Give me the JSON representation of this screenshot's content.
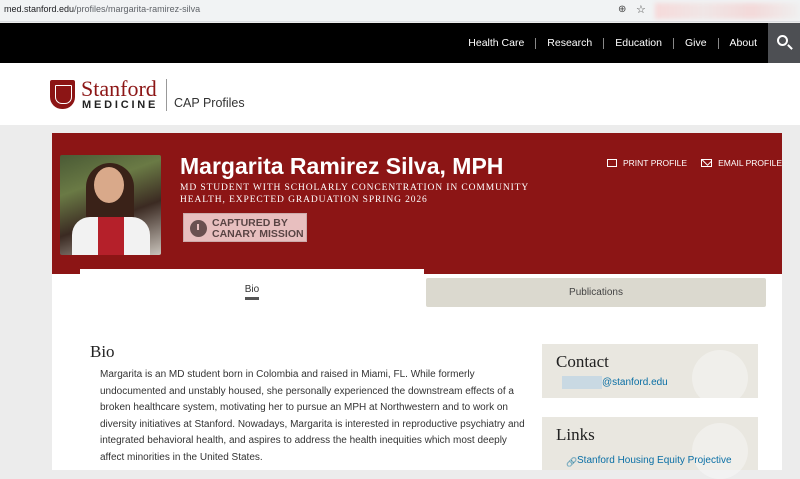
{
  "browser": {
    "url_host": "med.stanford.edu",
    "url_path": "/profiles/margarita-ramirez-silva"
  },
  "topnav": {
    "items": [
      "Health Care",
      "Research",
      "Education",
      "Give",
      "About"
    ]
  },
  "brand": {
    "wordmark": "Stanford",
    "subwordmark": "MEDICINE",
    "section": "CAP Profiles"
  },
  "profile": {
    "name": "Margarita Ramirez Silva, MPH",
    "title": "MD Student with Scholarly Concentration in Community Health, expected graduation Spring 2026",
    "badge": "Captured by Canary Mission",
    "print_label": "PRINT PROFILE",
    "email_label": "EMAIL PROFILE"
  },
  "tabs": {
    "bio": "Bio",
    "publications": "Publications"
  },
  "bio": {
    "heading": "Bio",
    "text": "Margarita is an MD student born in Colombia and raised in Miami, FL. While formerly undocumented and unstably housed, she personally experienced the downstream effects of a broken healthcare system, motivating her to pursue an MPH at Northwestern and to work on diversity initiatives at Stanford. Nowadays, Margarita is interested in reproductive psychiatry and integrated behavioral health, and aspires to address the health inequities which most deeply affect minorities in the United States."
  },
  "contact": {
    "heading": "Contact",
    "email_domain": "@stanford.edu"
  },
  "links": {
    "heading": "Links",
    "items": [
      "Stanford Housing Equity Projective"
    ]
  },
  "colors": {
    "cardinal": "#8c1515",
    "nav_bg": "#000000",
    "link": "#0a6fa5",
    "sidebox_bg": "#e9e7e0"
  }
}
